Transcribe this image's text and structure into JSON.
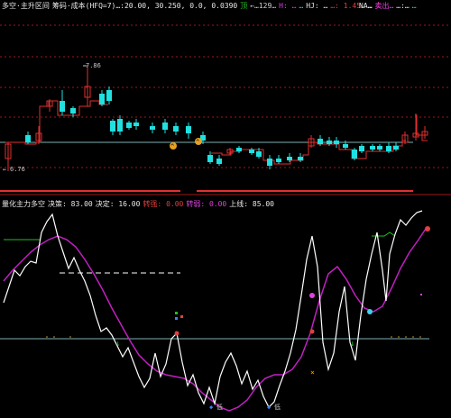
{
  "colors": {
    "bg": "#000000",
    "grid": "#a01818",
    "up": "#e03030",
    "down": "#20e0e0",
    "baseline": "#7fb0b0",
    "white_line": "#ffffff",
    "magenta_line": "#c020c0",
    "green_line": "#20c020",
    "orange_marker": "#e8a020"
  },
  "top_header": {
    "items": [
      {
        "text": "多空·主升区间",
        "color": "#e8e8e8"
      },
      {
        "text": "筹码·成本(HFQ=7)…:20.00, 30.250, 0.0, 0.0390",
        "color": "#e8e8e8"
      },
      {
        "text": "顶",
        "color": "#20c020"
      },
      {
        "text": "←…129…",
        "color": "#d0d0d0"
      },
      {
        "text": "H: …",
        "color": "#e040e0"
      },
      {
        "text": "…",
        "color": "#40d0d0"
      },
      {
        "text": "HJ: …",
        "color": "#e8e8e8"
      },
      {
        "text": "…: 1.45…",
        "color": "#e04040"
      },
      {
        "text": "…",
        "color": "#e8e8e8"
      },
      {
        "text": "卖",
        "color": "#e04040"
      }
    ],
    "right_items": [
      {
        "text": "NA…",
        "color": "#e8e8e8"
      },
      {
        "text": "卖出…",
        "color": "#e040e0"
      },
      {
        "text": "…:…",
        "color": "#e8e8e8"
      },
      {
        "text": "…",
        "color": "#40d0d0"
      }
    ]
  },
  "top_panel": {
    "high_label": "7.86",
    "low_label": "6.76",
    "low_arrow": "←"
  },
  "bottom_header": {
    "items": [
      {
        "text": "量化主力多空",
        "color": "#e8e8e8"
      },
      {
        "text": "决策: 83.00",
        "color": "#e8e8e8"
      },
      {
        "text": "决定: 16.00",
        "color": "#e8e8e8"
      },
      {
        "text": "转强: 0.00",
        "color": "#e04040"
      },
      {
        "text": "转弱: 0.00",
        "color": "#e040e0"
      },
      {
        "text": "上线: 85.00",
        "color": "#e8e8e8"
      }
    ]
  },
  "bottom_panel": {
    "label_low": "低"
  }
}
